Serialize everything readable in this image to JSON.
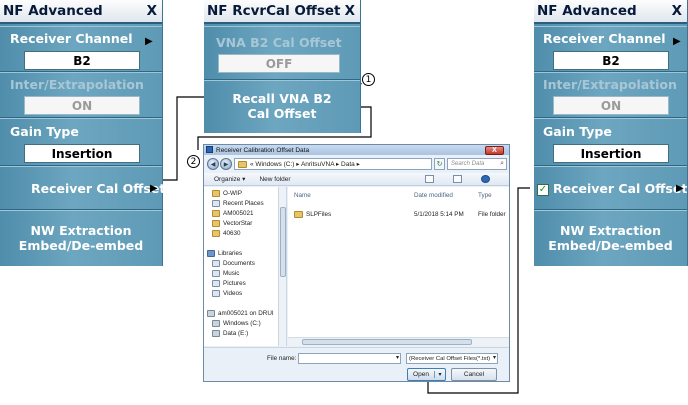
{
  "left_panel": {
    "title": "NF Advanced",
    "close": "X",
    "receiver_channel": {
      "label": "Receiver Channel",
      "value": "B2",
      "arrow": "▶"
    },
    "inter_extrapolation": {
      "label": "Inter/Extrapolation",
      "value": "ON"
    },
    "gain_type": {
      "label": "Gain Type",
      "value": "Insertion"
    },
    "receiver_cal_offset": {
      "label": "Receiver Cal Offset",
      "arrow": "▶"
    },
    "nw_extraction": {
      "line1": "NW Extraction",
      "line2": "Embed/De-embed"
    }
  },
  "middle_panel": {
    "title": "NF RcvrCal Offset",
    "close": "X",
    "vna_b2_cal_offset": {
      "label": "VNA B2 Cal Offset",
      "value": "OFF"
    },
    "recall": {
      "line1": "Recall VNA B2",
      "line2": "Cal Offset"
    }
  },
  "right_panel": {
    "title": "NF Advanced",
    "close": "X",
    "receiver_channel": {
      "label": "Receiver Channel",
      "value": "B2",
      "arrow": "▶"
    },
    "inter_extrapolation": {
      "label": "Inter/Extrapolation",
      "value": "ON"
    },
    "gain_type": {
      "label": "Gain Type",
      "value": "Insertion"
    },
    "receiver_cal_offset": {
      "label": "Receiver Cal Offset",
      "arrow": "▶",
      "check": "✓"
    },
    "nw_extraction": {
      "line1": "NW Extraction",
      "line2": "Embed/De-embed"
    }
  },
  "callouts": {
    "one": "1",
    "two": "2"
  },
  "dialog": {
    "title": "Receiver Calibration Offset Data",
    "close": "X",
    "back": "◀",
    "forward": "▶",
    "address": "« Windows (C:) ▸ AnritsuVNA ▸ Data ▸",
    "refresh": "↻",
    "search_placeholder": "Search Data",
    "search_icon": "⌕",
    "organize": "Organize ▾",
    "new_folder": "New folder",
    "nav_items": [
      {
        "label": "O-WIP"
      },
      {
        "label": "Recent Places"
      },
      {
        "label": "AM005021"
      },
      {
        "label": "VectorStar"
      },
      {
        "label": "40630"
      },
      {
        "label": "Libraries"
      },
      {
        "label": "Documents"
      },
      {
        "label": "Music"
      },
      {
        "label": "Pictures"
      },
      {
        "label": "Videos"
      },
      {
        "label": "am005021 on DRUI"
      },
      {
        "label": "Windows (C:)"
      },
      {
        "label": "Data (E:)"
      }
    ],
    "columns": {
      "name": "Name",
      "date": "Date modified",
      "type": "Type"
    },
    "files": [
      {
        "name": "SLPFiles",
        "date": "5/1/2018 5:14 PM",
        "type": "File folder"
      }
    ],
    "file_name_label": "File name:",
    "file_name_value": "",
    "file_type": "(Receiver Cal Offset Files(*.txt)",
    "open": "Open",
    "cancel": "Cancel",
    "dropdown": "▾"
  }
}
